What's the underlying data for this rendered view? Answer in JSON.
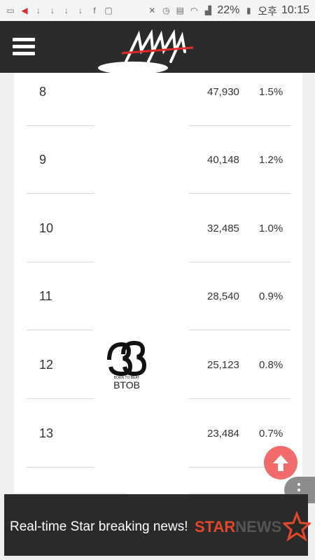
{
  "status_bar": {
    "battery": "22%",
    "ampm": "오후",
    "time": "10:15"
  },
  "rows": [
    {
      "rank": "8",
      "votes": "47,930",
      "percent": "1.5%"
    },
    {
      "rank": "9",
      "votes": "40,148",
      "percent": "1.2%"
    },
    {
      "rank": "10",
      "votes": "32,485",
      "percent": "1.0%"
    },
    {
      "rank": "11",
      "votes": "28,540",
      "percent": "0.9%"
    },
    {
      "rank": "12",
      "votes": "25,123",
      "percent": "0.8%",
      "artist": "BTOB"
    },
    {
      "rank": "13",
      "votes": "23,484",
      "percent": "0.7%"
    }
  ],
  "ad": {
    "text": "Real-time Star breaking news!",
    "brand_primary": "STAR",
    "brand_secondary": "NEWS"
  },
  "colors": {
    "header_bg": "#2b2b2b",
    "scroll_top_button": "#f26b6b",
    "ad_brand": "#e4472a"
  }
}
